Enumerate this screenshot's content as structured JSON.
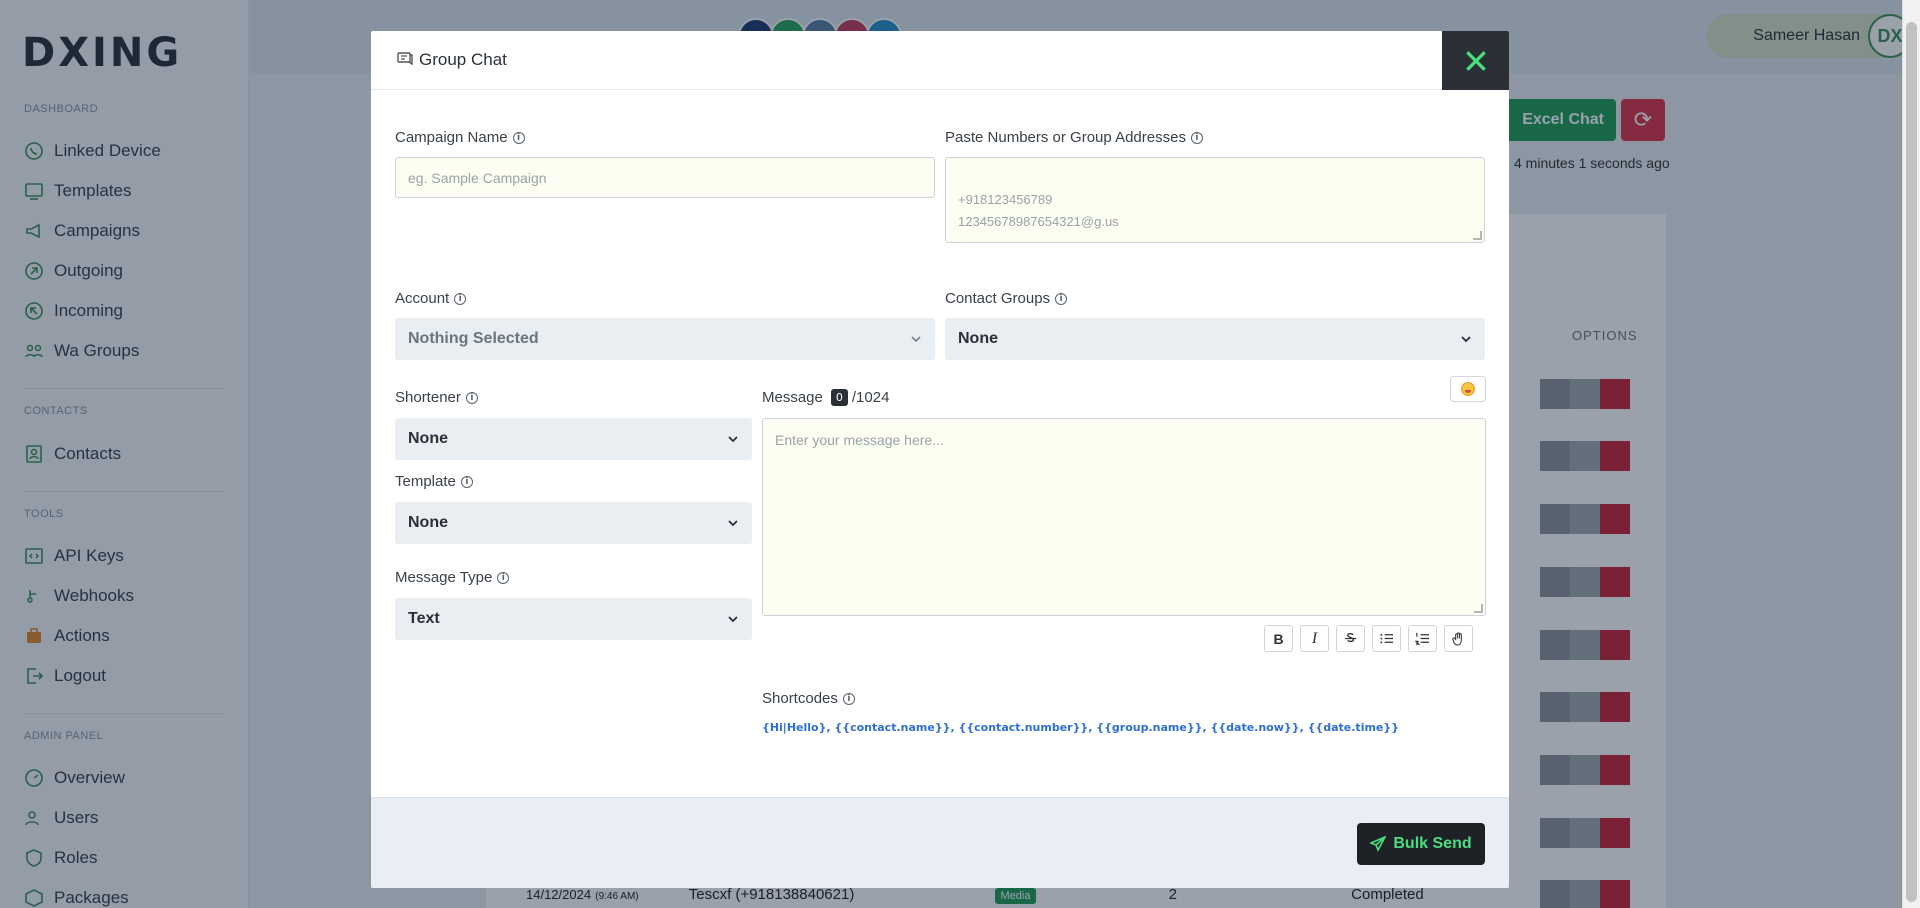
{
  "app": {
    "logo": "DXING",
    "user_name": "Sameer Hasan",
    "user_initials": "DX"
  },
  "sidebar": {
    "sections": [
      {
        "title": "DASHBOARD"
      },
      {
        "title": "CONTACTS"
      },
      {
        "title": "TOOLS"
      },
      {
        "title": "ADMIN PANEL"
      }
    ],
    "items": [
      {
        "label": "Linked Device",
        "icon": "whatsapp-icon"
      },
      {
        "label": "Templates",
        "icon": "templates-icon"
      },
      {
        "label": "Campaigns",
        "icon": "megaphone-icon"
      },
      {
        "label": "Outgoing",
        "icon": "outgoing-icon"
      },
      {
        "label": "Incoming",
        "icon": "incoming-icon"
      },
      {
        "label": "Wa Groups",
        "icon": "groups-icon"
      },
      {
        "label": "Contacts",
        "icon": "contacts-icon"
      },
      {
        "label": "API Keys",
        "icon": "code-icon"
      },
      {
        "label": "Webhooks",
        "icon": "webhook-icon"
      },
      {
        "label": "Actions",
        "icon": "actions-icon"
      },
      {
        "label": "Logout",
        "icon": "logout-icon"
      },
      {
        "label": "Overview",
        "icon": "overview-icon"
      },
      {
        "label": "Users",
        "icon": "users-icon"
      },
      {
        "label": "Roles",
        "icon": "shield-icon"
      },
      {
        "label": "Packages",
        "icon": "packages-icon"
      }
    ]
  },
  "background": {
    "excel_button": "Excel Chat",
    "updated_text": "4 minutes 1 seconds ago",
    "options_header": "OPTIONS",
    "last_row": {
      "date": "14/12/2024",
      "time": "(9:46 AM)",
      "name": "Tescxf (+918138840621)",
      "type": "Media",
      "count": "2",
      "status": "Completed"
    }
  },
  "modal": {
    "title": "Group Chat",
    "campaign_name": {
      "label": "Campaign Name",
      "placeholder": "eg. Sample Campaign"
    },
    "numbers": {
      "label": "Paste Numbers or Group Addresses",
      "placeholder_line1": "+918123456789",
      "placeholder_line2": "12345678987654321@g.us"
    },
    "account": {
      "label": "Account",
      "value": "Nothing Selected"
    },
    "contact_groups": {
      "label": "Contact Groups",
      "value": "None"
    },
    "shortener": {
      "label": "Shortener",
      "value": "None"
    },
    "template": {
      "label": "Template",
      "value": "None"
    },
    "message_type": {
      "label": "Message Type",
      "value": "Text"
    },
    "message": {
      "label": "Message",
      "count": "0",
      "max": "/1024",
      "placeholder": "Enter your message here..."
    },
    "toolbar": {
      "bold": "B",
      "italic": "I"
    },
    "shortcodes": {
      "label": "Shortcodes",
      "text": "{Hi|Hello}, {{contact.name}}, {{contact.number}}, {{group.name}}, {{date.now}}, {{date.time}}"
    },
    "submit_label": "Bulk Send"
  },
  "colors": {
    "accent": "#4ade80",
    "dark": "#2b3036",
    "danger": "#dc3545",
    "link": "#2e6fd1"
  }
}
